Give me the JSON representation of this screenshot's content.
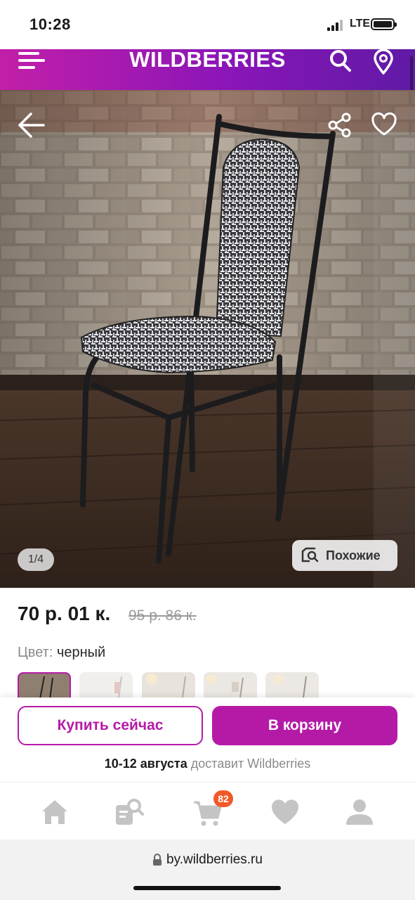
{
  "status_bar": {
    "time": "10:28",
    "network": "LTE"
  },
  "header": {
    "brand": "WILDBERRIES",
    "icons": [
      "menu-icon",
      "search-icon",
      "location-pin-icon"
    ]
  },
  "product": {
    "photo_counter": "1/4",
    "similar_label": "Похожие",
    "price": "70 р. 01 к.",
    "old_price": "95 р. 86 к.",
    "color_label": "Цвет:",
    "color_value": "черный",
    "thumbnails_count": 5
  },
  "actions": {
    "buy_now": "Купить сейчас",
    "add_to_cart": "В корзину",
    "delivery_date": "10-12 августа",
    "delivery_text": "доставит Wildberries"
  },
  "bottom_nav": {
    "items": [
      "home-icon",
      "catalog-search-icon",
      "cart-icon",
      "favorites-icon",
      "profile-icon"
    ],
    "cart_badge": "82"
  },
  "browser": {
    "url": "by.wildberries.ru"
  },
  "colors": {
    "accent": "#b51aa7",
    "header_start": "#c21fa8",
    "header_end": "#5f1aa5",
    "badge": "#f05a28"
  }
}
